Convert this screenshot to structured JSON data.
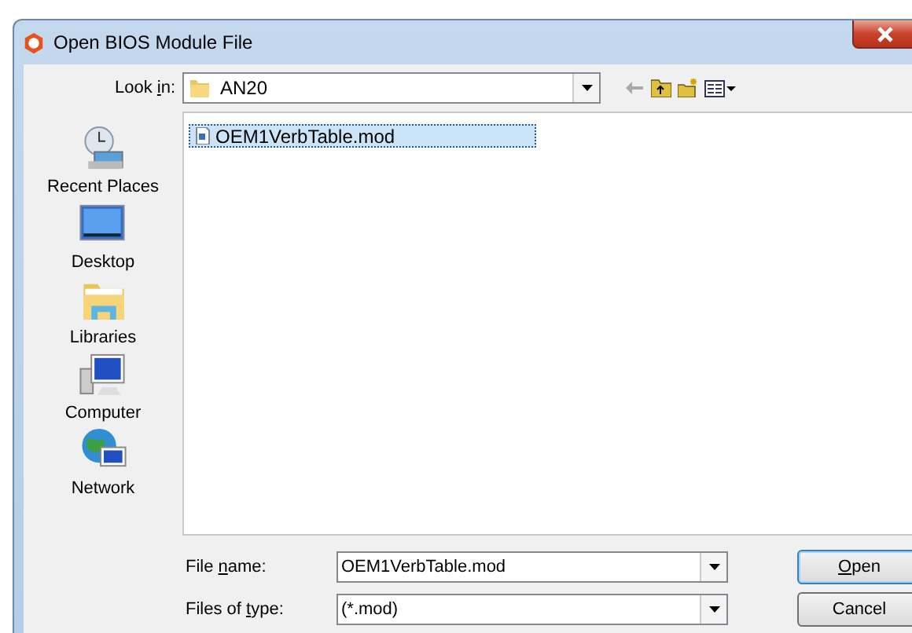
{
  "window": {
    "title": "Open BIOS Module File"
  },
  "look_in": {
    "label": [
      {
        "text": "Look ",
        "access_key": false
      },
      {
        "text": "i",
        "access_key": true
      },
      {
        "text": "n:",
        "access_key": false
      }
    ],
    "value": "AN20"
  },
  "places": [
    {
      "label": "Recent Places",
      "kind": "recent"
    },
    {
      "label": "Desktop",
      "kind": "desktop"
    },
    {
      "label": "Libraries",
      "kind": "libraries"
    },
    {
      "label": "Computer",
      "kind": "computer"
    },
    {
      "label": "Network",
      "kind": "network"
    }
  ],
  "files": [
    {
      "name": "OEM1VerbTable.mod",
      "selected": true
    }
  ],
  "file_name": {
    "label": [
      {
        "text": "File ",
        "access_key": false
      },
      {
        "text": "n",
        "access_key": true
      },
      {
        "text": "ame:",
        "access_key": false
      }
    ],
    "value": "OEM1VerbTable.mod"
  },
  "file_type": {
    "label": [
      {
        "text": "Files of ",
        "access_key": false
      },
      {
        "text": "t",
        "access_key": true
      },
      {
        "text": "ype:",
        "access_key": false
      }
    ],
    "value": "(*.mod)"
  },
  "buttons": [
    {
      "label": [
        {
          "text": "O",
          "access_key": true
        },
        {
          "text": "pen",
          "access_key": false
        }
      ]
    },
    {
      "label": [
        {
          "text": "Cancel",
          "access_key": false
        }
      ]
    }
  ]
}
